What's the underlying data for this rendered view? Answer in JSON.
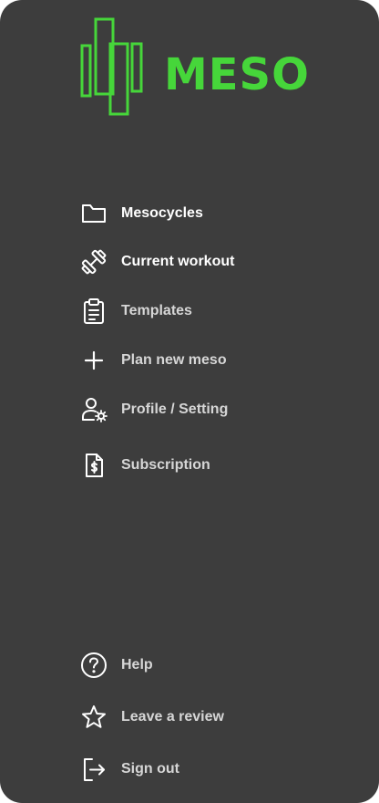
{
  "app": {
    "logo_text": "MESO",
    "brand_color": "#46d63a"
  },
  "menu": {
    "items": [
      {
        "label": "Mesocycles",
        "icon": "folder-icon"
      },
      {
        "label": "Current workout",
        "icon": "dumbbell-icon"
      },
      {
        "label": "Templates",
        "icon": "clipboard-icon"
      },
      {
        "label": "Plan new meso",
        "icon": "plus-icon"
      },
      {
        "label": "Profile / Setting",
        "icon": "user-settings-icon"
      },
      {
        "label": "Subscription",
        "icon": "dollar-document-icon"
      }
    ]
  },
  "footer": {
    "items": [
      {
        "label": "Help",
        "icon": "help-icon"
      },
      {
        "label": "Leave a review",
        "icon": "star-icon"
      },
      {
        "label": "Sign out",
        "icon": "sign-out-icon"
      }
    ]
  }
}
